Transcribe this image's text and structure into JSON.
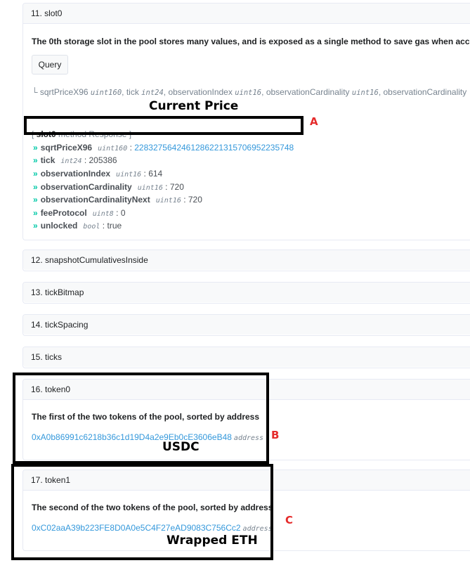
{
  "slot0": {
    "header": "11. slot0",
    "description": "The 0th storage slot in the pool stores many values, and is exposed as a single method to save gas when acc",
    "query_label": "Query",
    "signature": {
      "prefix": "└ ",
      "parts": [
        {
          "name": "sqrtPriceX96",
          "type": "uint160"
        },
        {
          "name": "tick",
          "type": "int24"
        },
        {
          "name": "observationIndex",
          "type": "uint16"
        },
        {
          "name": "observationCardinality",
          "type": "uint16"
        },
        {
          "name": "observationCardinality",
          "type": ""
        }
      ]
    },
    "response_open": "[ ",
    "response_method": "slot0",
    "response_suffix": " method Response ]",
    "rows": [
      {
        "name": "sqrtPriceX96",
        "type": "uint160",
        "value": "2283275642461286221315706952235748"
      },
      {
        "name": "tick",
        "type": "int24",
        "value": "205386"
      },
      {
        "name": "observationIndex",
        "type": "uint16",
        "value": "614"
      },
      {
        "name": "observationCardinality",
        "type": "uint16",
        "value": "720"
      },
      {
        "name": "observationCardinalityNext",
        "type": "uint16",
        "value": "720"
      },
      {
        "name": "feeProtocol",
        "type": "uint8",
        "value": "0"
      },
      {
        "name": "unlocked",
        "type": "bool",
        "value": "true"
      }
    ]
  },
  "collapsed": [
    {
      "header": "12. snapshotCumulativesInside"
    },
    {
      "header": "13. tickBitmap"
    },
    {
      "header": "14. tickSpacing"
    },
    {
      "header": "15. ticks"
    }
  ],
  "token0": {
    "header": "16. token0",
    "description": "The first of the two tokens of the pool, sorted by address",
    "address": "0xA0b86991c6218b36c1d19D4a2e9Eb0cE3606eB48",
    "type": "address"
  },
  "token1": {
    "header": "17. token1",
    "description": "The second of the two tokens of the pool, sorted by address",
    "address": "0xC02aaA39b223FE8D0A0e5C4F27eAD9083C756Cc2",
    "type": "address"
  },
  "annotations": {
    "current_price": "Current Price",
    "usdc": "USDC",
    "wrapped_eth": "Wrapped ETH",
    "letter_a": "A",
    "letter_b": "B",
    "letter_c": "C"
  },
  "colors": {
    "link": "#3498db",
    "chevron": "#00c9a7",
    "annotation_letter": "#e52b2b"
  }
}
